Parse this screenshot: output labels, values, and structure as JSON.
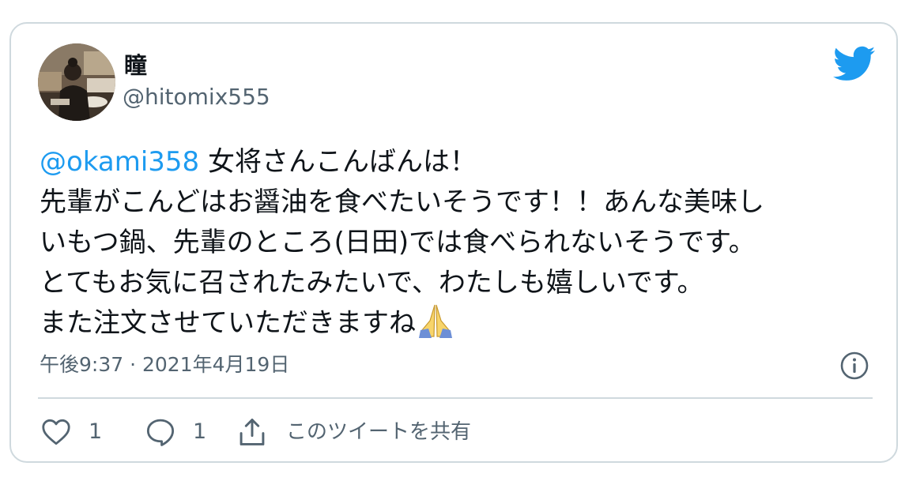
{
  "user": {
    "display_name": "瞳",
    "handle": "@hitomix555"
  },
  "tweet": {
    "mention": "@okami358",
    "line1_rest": " 女将さんこんばんは！",
    "line2": "先輩がこんどはお醤油を食べたいそうです！！あんな美味し",
    "line3": "いもつ鍋、先輩のところ(日田)では食べられないそうです。",
    "line4": "とてもお気に召されたみたいで、わたしも嬉しいです。",
    "line5": "また注文させていただきますね",
    "emoji": "folded-hands"
  },
  "meta": {
    "timestamp": "午後9:37 · 2021年4月19日"
  },
  "actions": {
    "like_count": "1",
    "reply_count": "1",
    "share_label": "このツイートを共有"
  },
  "colors": {
    "accent": "#1d9bf0",
    "muted": "#536471",
    "border": "#cfd9de"
  }
}
